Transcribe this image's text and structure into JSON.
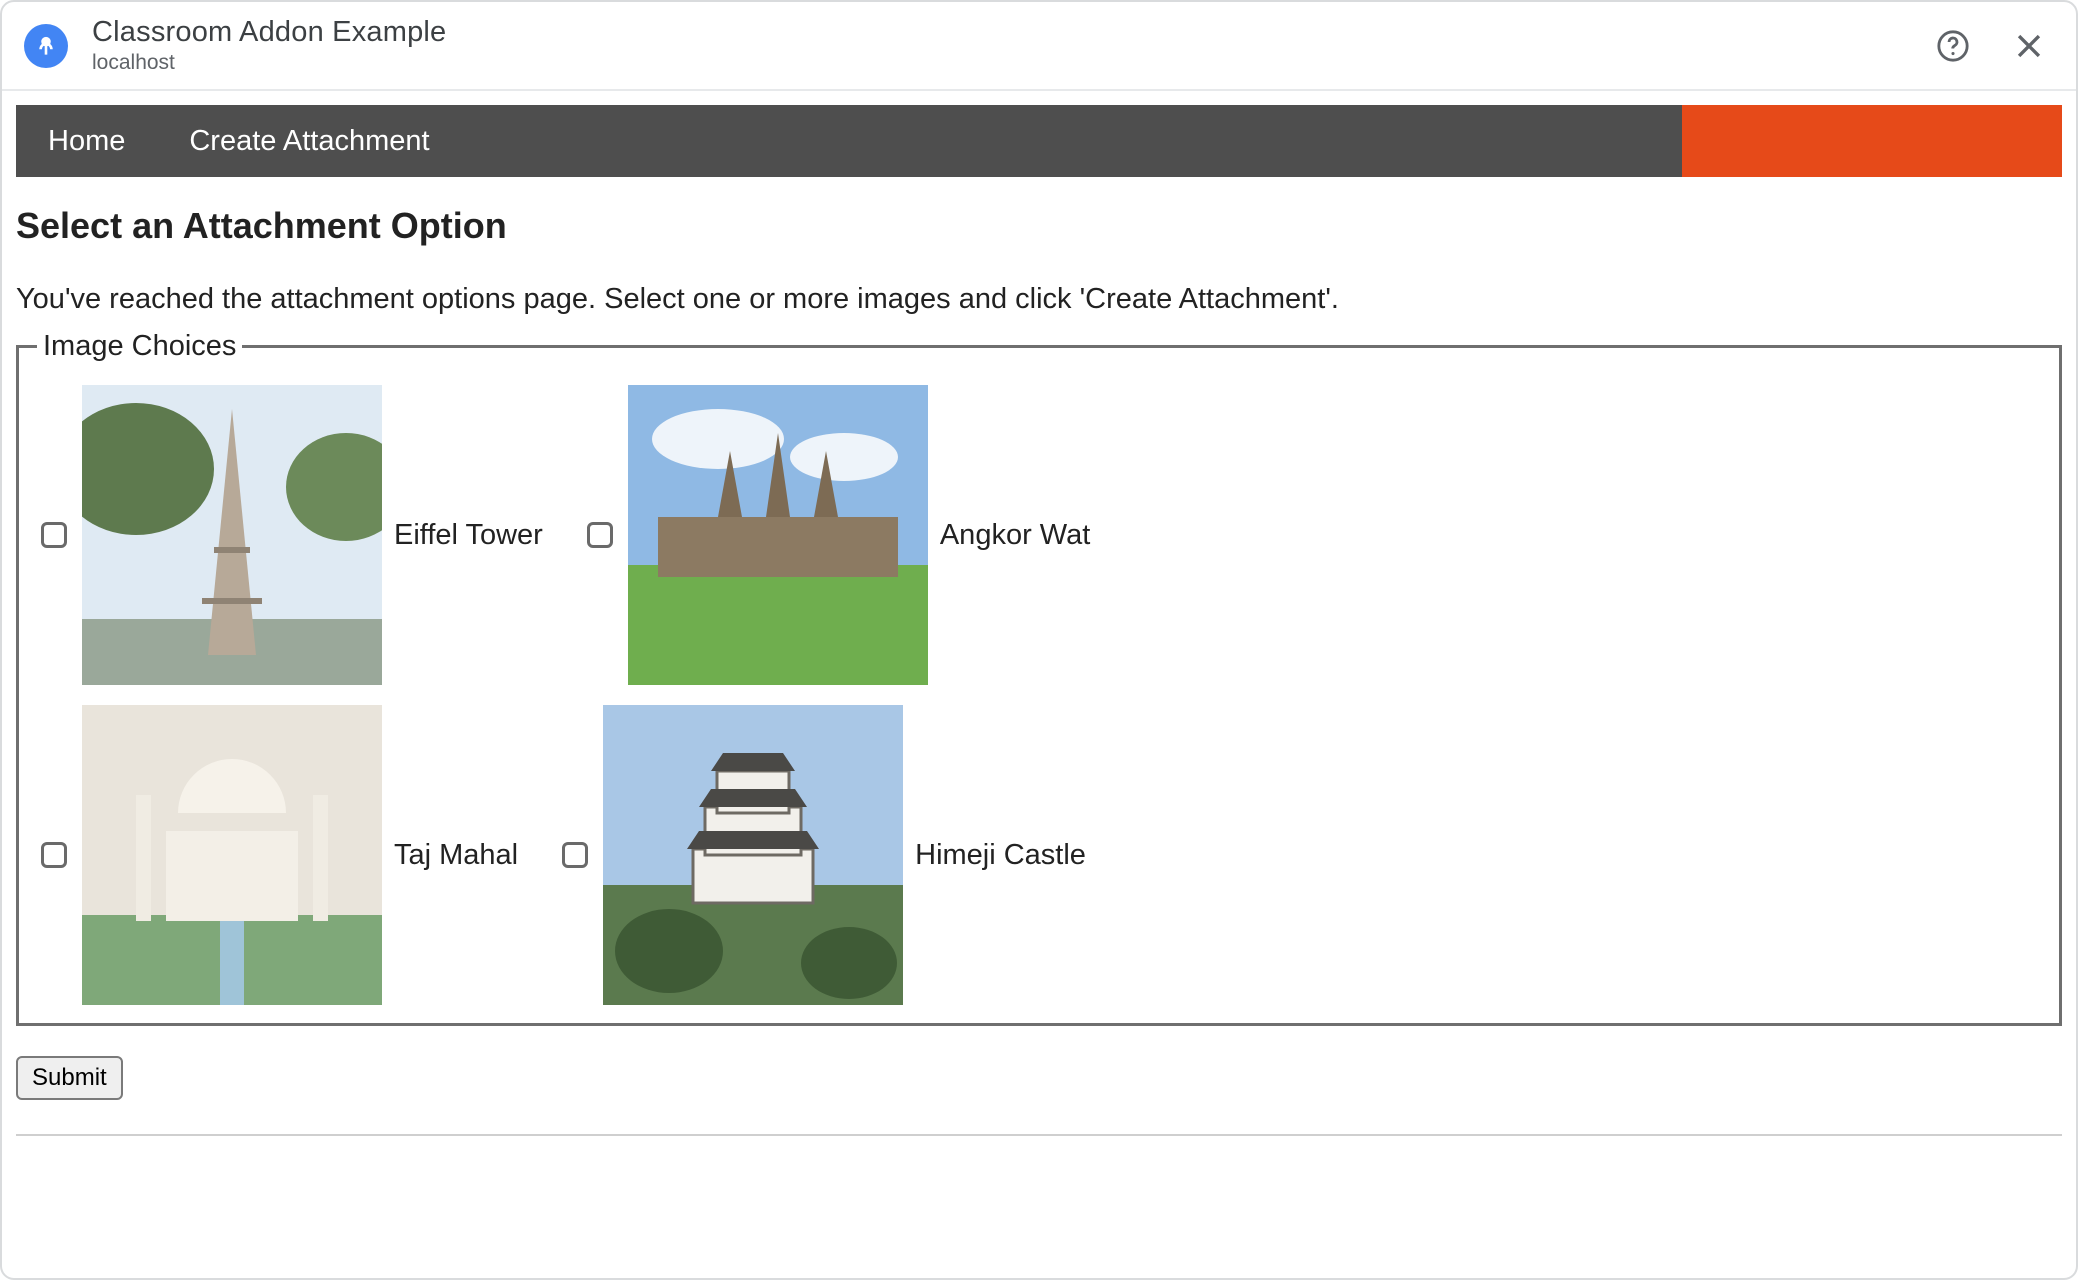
{
  "dialog": {
    "title": "Classroom Addon Example",
    "subtitle": "localhost",
    "help_icon": "help-circle-icon",
    "close_icon": "close-icon",
    "app_icon": "addon-icon"
  },
  "nav": {
    "items": [
      {
        "label": "Home"
      },
      {
        "label": "Create Attachment"
      }
    ]
  },
  "page": {
    "heading": "Select an Attachment Option",
    "lead": "You've reached the attachment options page. Select one or more images and click 'Create Attachment'.",
    "fieldset_legend": "Image Choices",
    "choices": [
      {
        "label": "Eiffel Tower",
        "checked": false
      },
      {
        "label": "Angkor Wat",
        "checked": false
      },
      {
        "label": "Taj Mahal",
        "checked": false
      },
      {
        "label": "Himeji Castle",
        "checked": false
      }
    ],
    "submit_label": "Submit"
  }
}
